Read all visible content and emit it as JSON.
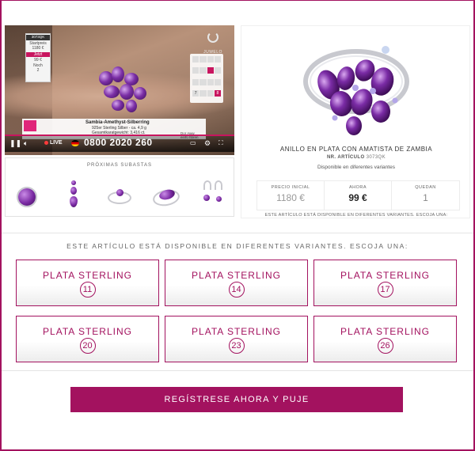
{
  "colors": {
    "brand": "#a3125f",
    "live_dot": "#ff3b3b"
  },
  "video": {
    "lot_card": {
      "code": "3073QK",
      "start_label": "Startpreis",
      "start_price": "1180 €",
      "now_label": "Jetzt",
      "now_price": "99 €",
      "remaining_label": "Noch",
      "remaining": "2"
    },
    "logo_text": "JUWELO",
    "calendar": [
      "",
      "",
      "",
      "",
      "",
      "",
      "",
      "",
      "",
      "",
      "",
      "",
      "7",
      "",
      "",
      "8"
    ],
    "product_name": "Sambia-Amethyst-Silberring",
    "product_meta": [
      "925er Sterling Silber - ca. 4,9 g",
      "Gesamtkaratgewicht: 3,416 ct."
    ],
    "side_note": [
      "Dor Aww",
      "einfü hbren"
    ],
    "controls": {
      "pause_icon": "pause-icon",
      "volume_icon": "volume-icon",
      "live_label": "LIVE",
      "phone": "0800 2020 260",
      "cast_icon": "cast-icon",
      "settings_icon": "gear-icon",
      "fullscreen_icon": "fullscreen-icon"
    }
  },
  "upcoming": {
    "title": "PRÓXIMAS SUBASTAS",
    "items": [
      "round-gem-ring",
      "drop-earrings",
      "thin-band-ring",
      "oval-gem-ring",
      "hook-earrings"
    ]
  },
  "product": {
    "title": "ANILLO EN PLATA CON AMATISTA DE ZAMBIA",
    "article_label": "NR. ARTÍCULO",
    "article_code": "3073QK",
    "availability": "Disponible en diferentes variantes",
    "prices": [
      {
        "label": "PRECIO INICIAL",
        "value": "1180 €"
      },
      {
        "label": "AHORA",
        "value": "99 €"
      },
      {
        "label": "QUEDAN",
        "value": "1"
      }
    ],
    "note": "ESTE ARTÍCULO ESTÁ DISPONIBLE EN DIFERENTES VARIANTES. ESCOJA UNA:"
  },
  "variants": {
    "header": "ESTE ARTÍCULO ESTÁ DISPONIBLE EN DIFERENTES VARIANTES. ESCOJA UNA:",
    "items": [
      {
        "label": "PLATA STERLING",
        "size": "11"
      },
      {
        "label": "PLATA STERLING",
        "size": "14"
      },
      {
        "label": "PLATA STERLING",
        "size": "17"
      },
      {
        "label": "PLATA STERLING",
        "size": "20"
      },
      {
        "label": "PLATA STERLING",
        "size": "23"
      },
      {
        "label": "PLATA STERLING",
        "size": "26"
      }
    ]
  },
  "cta": {
    "label": "REGÍSTRESE AHORA Y PUJE"
  }
}
